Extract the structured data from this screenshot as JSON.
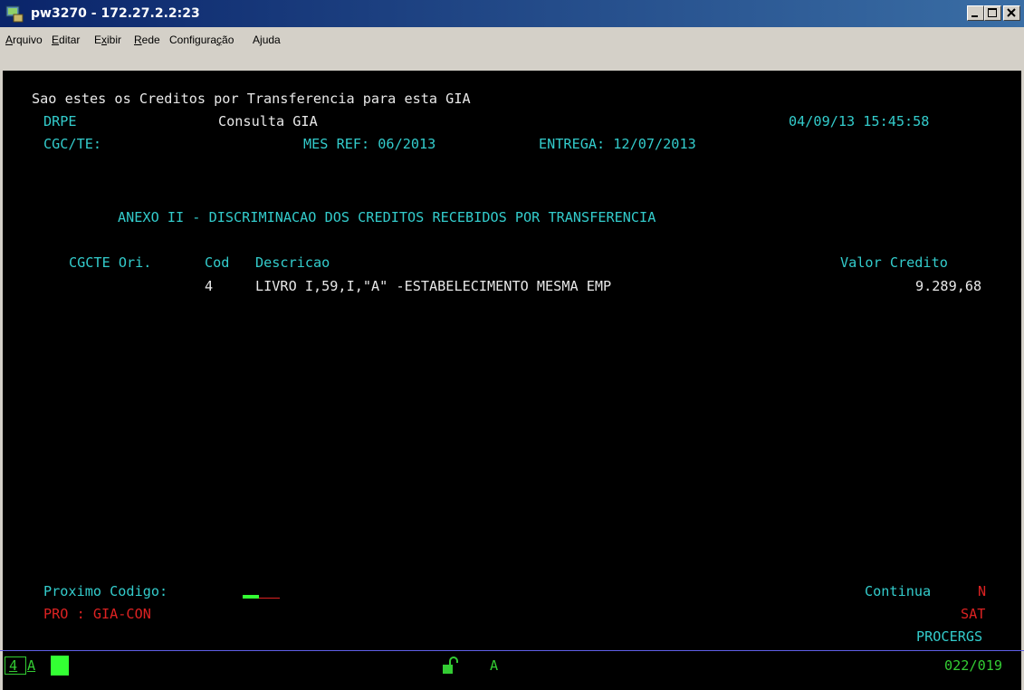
{
  "window": {
    "title": "pw3270 - 172.27.2.2:23",
    "controls": [
      "minimize",
      "maximize",
      "close"
    ]
  },
  "menubar": {
    "items": [
      {
        "label_pre": "",
        "label_ul": "A",
        "label_post": "rquivo"
      },
      {
        "label_pre": "",
        "label_ul": "E",
        "label_post": "ditar"
      },
      {
        "label_pre": "E",
        "label_ul": "x",
        "label_post": "ibir"
      },
      {
        "label_pre": "",
        "label_ul": "R",
        "label_post": "ede"
      },
      {
        "label_pre": "Configura",
        "label_ul": "ç",
        "label_post": "ão"
      },
      {
        "label_pre": "A",
        "label_ul": "j",
        "label_post": "uda"
      }
    ]
  },
  "screen": {
    "intro": "Sao estes os Creditos por Transferencia para esta GIA",
    "system": "DRPE",
    "screen_title": "Consulta GIA",
    "datetime": "04/09/13 15:45:58",
    "cgc_label": "CGC/TE:",
    "mes_ref": "MES REF: 06/2013",
    "entrega": "ENTREGA: 12/07/2013",
    "section_heading": "ANEXO II - DISCRIMINACAO DOS CREDITOS RECEBIDOS POR TRANSFERENCIA",
    "table": {
      "headers": {
        "origin": "CGCTE Ori.",
        "code": "Cod",
        "description": "Descricao",
        "value": "Valor Credito"
      },
      "rows": [
        {
          "origin": "",
          "code": "4",
          "description": "LIVRO I,59,I,\"A\" -ESTABELECIMENTO MESMA EMP",
          "value": "9.289,68"
        }
      ]
    },
    "next_code_label": "Proximo Codigo:",
    "continua_label": "Continua",
    "continua_value": "N",
    "program": "PRO : GIA-CON",
    "sat": "SAT",
    "procergs": "PROCERGS"
  },
  "status": {
    "box_label": "4",
    "mode": "A",
    "ssl_mode": "A",
    "cursor_pos": "022/019"
  },
  "colors": {
    "terminal_bg": "#000000",
    "text_white": "#e8e8e8",
    "text_cyan": "#33cccc",
    "text_green": "#33cc33",
    "text_red": "#dd2222"
  }
}
